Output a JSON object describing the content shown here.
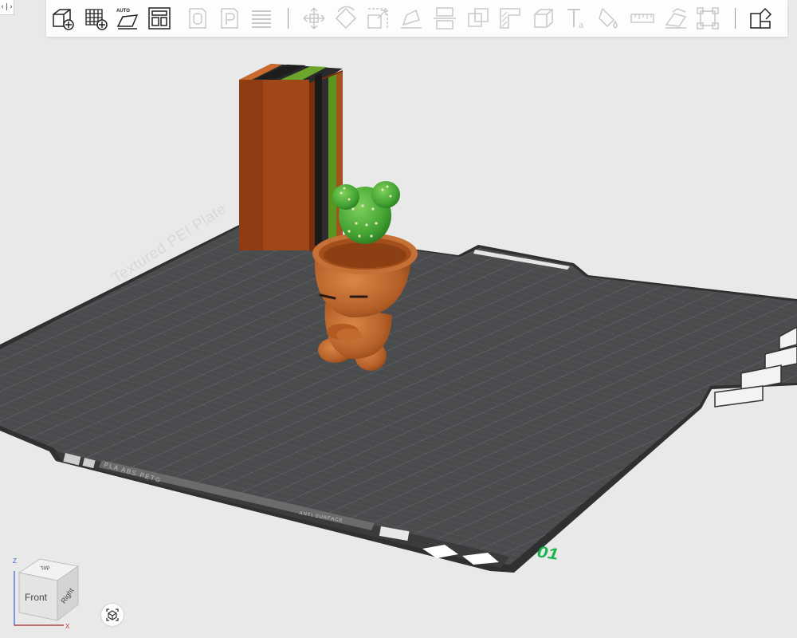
{
  "collapse_toggle": {
    "label": "‹|›",
    "icon": "sidebar-toggle-icon"
  },
  "toolbar": {
    "left_group": [
      {
        "icon": "add-object-icon",
        "tooltip": ""
      },
      {
        "icon": "add-plate-icon",
        "tooltip": ""
      },
      {
        "icon": "auto-orient-icon",
        "badge": "AUTO"
      },
      {
        "icon": "arrange-icon",
        "tooltip": ""
      },
      {
        "icon": "split-objects-icon",
        "tooltip": ""
      },
      {
        "icon": "split-parts-icon",
        "tooltip": ""
      },
      {
        "icon": "variable-layer-height-icon",
        "tooltip": ""
      }
    ],
    "middle_group": [
      "move-icon",
      "rotate-icon",
      "scale-icon",
      "lay-on-face-icon",
      "cut-icon",
      "boolean-icon",
      "support-paint-icon",
      "seam-paint-icon",
      "text-icon",
      "color-paint-icon",
      "measure-icon",
      "assembly-icon",
      "mesh-repair-icon"
    ],
    "right_group": [
      "assembly-view-icon"
    ]
  },
  "plate": {
    "label": "Textured PEI Plate",
    "number": "01",
    "material": "PLA  ABS  PETG",
    "surface_label": "ANTI SURFACE"
  },
  "plate_tools": [
    "arrange-plate-icon",
    "orient-plate-icon",
    "plate-settings-icon",
    "lock-plate-icon",
    "plate-type-icon"
  ],
  "view_cube": {
    "front": "Front",
    "right": "Right",
    "top": "Top",
    "axis_z": "Z",
    "axis_x": "X"
  },
  "camera_button": {
    "icon": "camera-view-icon"
  },
  "colors": {
    "background": "#e9e9ea",
    "plate": "#4a4b4d",
    "plate_edge": "#2f3031",
    "grid": "#747679",
    "plate_number": "#18b34a",
    "pot": "#b9652d",
    "cactus": "#4caf3a",
    "wipe_tower_orange": "#9a4413",
    "wipe_tower_green": "#55961e"
  }
}
